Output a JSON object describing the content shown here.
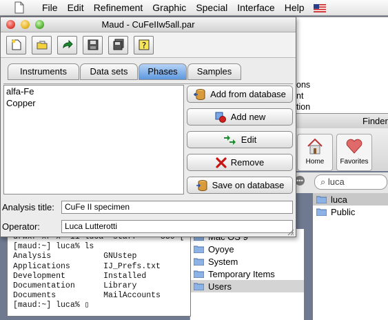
{
  "menubar": {
    "items": [
      "File",
      "Edit",
      "Refinement",
      "Graphic",
      "Special",
      "Interface",
      "Help"
    ],
    "app_icon": "document-icon",
    "flag_icon": "us-flag-icon"
  },
  "window": {
    "title": "Maud - CuFeIIw5all.par",
    "toolbar": {
      "new_icon": "new-file-icon",
      "open_icon": "open-folder-icon",
      "reload_icon": "green-arrow-icon",
      "save_icon": "floppy-icon",
      "saveas_icon": "floppy-stack-icon",
      "help_icon": "question-icon"
    },
    "tabs": [
      {
        "label": "Instruments",
        "active": false
      },
      {
        "label": "Data sets",
        "active": false
      },
      {
        "label": "Phases",
        "active": true
      },
      {
        "label": "Samples",
        "active": false
      }
    ],
    "phases": [
      "alfa-Fe",
      "Copper"
    ],
    "buttons": {
      "add_from_db": "Add from database",
      "add_new": "Add new",
      "edit": "Edit",
      "remove": "Remove",
      "save_db": "Save on database"
    },
    "analysis_title_label": "Analysis title:",
    "analysis_title_value": "CuFe II specimen",
    "operator_label": "Operator:",
    "operator_value": "Luca Lutterotti"
  },
  "behind": {
    "right_fragments": [
      "ons",
      "nt",
      "tion"
    ],
    "finder_title": "Finder",
    "home_label": "Home",
    "favorites_label": "Favorites",
    "search_value": "luca",
    "finder_items": [
      "Mac OS 9",
      "Oyoye",
      "System",
      "Temporary Items",
      "Users"
    ],
    "finder_selected": "Users",
    "user_folders": [
      "luca",
      "Public"
    ],
    "user_selected": "luca"
  },
  "terminal": {
    "lines": [
      "drwxr-xr-x  11 luca  staff     330 [",
      "[maud:~] luca% ls",
      "Analysis           GNUstep",
      "Applications       IJ_Prefs.txt",
      "Development        Installed",
      "Documentation      Library",
      "Documents          MailAccounts",
      "[maud:~] luca% ▯"
    ]
  },
  "colors": {
    "active_tab": "#5e98e0",
    "close": "#e2443a",
    "minimize": "#e8b72a",
    "zoom": "#5cb73a"
  }
}
